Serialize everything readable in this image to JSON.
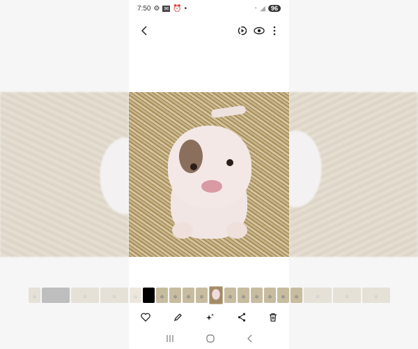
{
  "status_bar": {
    "time": "7:50",
    "battery": "96"
  },
  "top_bar": {
    "icons": [
      "back-icon",
      "motion-photo-icon",
      "eye-icon",
      "more-icon"
    ]
  },
  "filmstrip": {
    "thumbnail_count": 12,
    "selected_index": 6
  },
  "actions": {
    "icons": [
      "heart-icon",
      "edit-pencil-icon",
      "sparkle-icon",
      "share-icon",
      "delete-icon"
    ]
  },
  "nav": {
    "icons": [
      "recents-icon",
      "home-icon",
      "back-icon"
    ]
  },
  "colors": {
    "background": "#f4f4f4",
    "text": "#222222"
  }
}
